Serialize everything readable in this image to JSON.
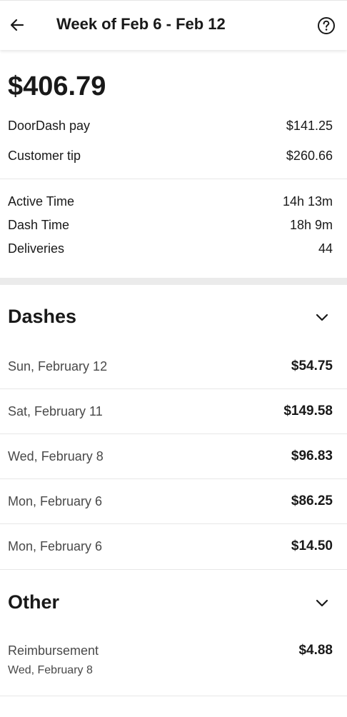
{
  "header": {
    "title": "Week of Feb 6 - Feb 12",
    "back_icon": "arrow-left-icon",
    "help_icon": "question-circle-icon"
  },
  "summary": {
    "total": "$406.79",
    "doordash_pay_label": "DoorDash pay",
    "doordash_pay_value": "$141.25",
    "customer_tip_label": "Customer tip",
    "customer_tip_value": "$260.66"
  },
  "stats": {
    "active_time_label": "Active Time",
    "active_time_value": "14h 13m",
    "dash_time_label": "Dash Time",
    "dash_time_value": "18h 9m",
    "deliveries_label": "Deliveries",
    "deliveries_value": "44"
  },
  "dashes": {
    "title": "Dashes",
    "items": [
      {
        "date": "Sun, February 12",
        "amount": "$54.75"
      },
      {
        "date": "Sat, February 11",
        "amount": "$149.58"
      },
      {
        "date": "Wed, February 8",
        "amount": "$96.83"
      },
      {
        "date": "Mon, February 6",
        "amount": "$86.25"
      },
      {
        "date": "Mon, February 6",
        "amount": "$14.50"
      }
    ]
  },
  "other": {
    "title": "Other",
    "items": [
      {
        "label": "Reimbursement",
        "date": "Wed, February 8",
        "amount": "$4.88"
      }
    ]
  }
}
